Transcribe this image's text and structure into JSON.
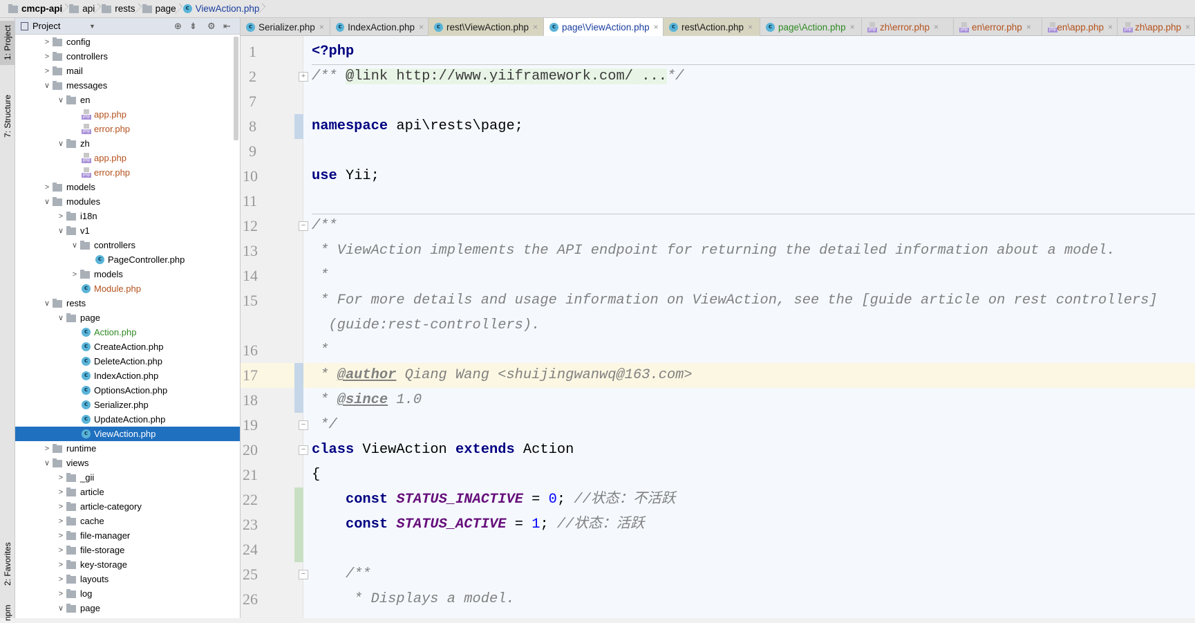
{
  "breadcrumb": [
    "cmcp-api",
    "api",
    "rests",
    "page",
    "ViewAction.php"
  ],
  "tool_strip": {
    "project": "1: Project",
    "structure": "7: Structure",
    "favorites": "2: Favorites",
    "npm": "npm"
  },
  "sidebar": {
    "title": "Project",
    "items": [
      {
        "label": "config",
        "level": 0,
        "type": "folder",
        "state": "collapsed"
      },
      {
        "label": "controllers",
        "level": 0,
        "type": "folder",
        "state": "collapsed"
      },
      {
        "label": "mail",
        "level": 0,
        "type": "folder",
        "state": "collapsed"
      },
      {
        "label": "messages",
        "level": 0,
        "type": "folder",
        "state": "expanded"
      },
      {
        "label": "en",
        "level": 1,
        "type": "folder",
        "state": "expanded"
      },
      {
        "label": "app.php",
        "level": 2,
        "type": "php",
        "color": "#b4511c"
      },
      {
        "label": "error.php",
        "level": 2,
        "type": "php",
        "color": "#b4511c"
      },
      {
        "label": "zh",
        "level": 1,
        "type": "folder",
        "state": "expanded"
      },
      {
        "label": "app.php",
        "level": 2,
        "type": "php",
        "color": "#b4511c"
      },
      {
        "label": "error.php",
        "level": 2,
        "type": "php",
        "color": "#b4511c"
      },
      {
        "label": "models",
        "level": 0,
        "type": "folder",
        "state": "collapsed"
      },
      {
        "label": "modules",
        "level": 0,
        "type": "folder",
        "state": "expanded"
      },
      {
        "label": "i18n",
        "level": 1,
        "type": "folder",
        "state": "collapsed"
      },
      {
        "label": "v1",
        "level": 1,
        "type": "folder",
        "state": "expanded"
      },
      {
        "label": "controllers",
        "level": 2,
        "type": "folder",
        "state": "expanded"
      },
      {
        "label": "PageController.php",
        "level": 3,
        "type": "class"
      },
      {
        "label": "models",
        "level": 2,
        "type": "folder",
        "state": "collapsed"
      },
      {
        "label": "Module.php",
        "level": 2,
        "type": "class",
        "color": "#b4511c"
      },
      {
        "label": "rests",
        "level": 0,
        "type": "folder",
        "state": "expanded"
      },
      {
        "label": "page",
        "level": 1,
        "type": "folder",
        "state": "expanded"
      },
      {
        "label": "Action.php",
        "level": 2,
        "type": "class",
        "color": "#2f8a24"
      },
      {
        "label": "CreateAction.php",
        "level": 2,
        "type": "class"
      },
      {
        "label": "DeleteAction.php",
        "level": 2,
        "type": "class"
      },
      {
        "label": "IndexAction.php",
        "level": 2,
        "type": "class"
      },
      {
        "label": "OptionsAction.php",
        "level": 2,
        "type": "class"
      },
      {
        "label": "Serializer.php",
        "level": 2,
        "type": "class"
      },
      {
        "label": "UpdateAction.php",
        "level": 2,
        "type": "class"
      },
      {
        "label": "ViewAction.php",
        "level": 2,
        "type": "class",
        "selected": true
      },
      {
        "label": "runtime",
        "level": 0,
        "type": "folder",
        "state": "collapsed"
      },
      {
        "label": "views",
        "level": 0,
        "type": "folder",
        "state": "expanded"
      },
      {
        "label": "_gii",
        "level": 1,
        "type": "folder",
        "state": "collapsed"
      },
      {
        "label": "article",
        "level": 1,
        "type": "folder",
        "state": "collapsed"
      },
      {
        "label": "article-category",
        "level": 1,
        "type": "folder",
        "state": "collapsed"
      },
      {
        "label": "cache",
        "level": 1,
        "type": "folder",
        "state": "collapsed"
      },
      {
        "label": "file-manager",
        "level": 1,
        "type": "folder",
        "state": "collapsed"
      },
      {
        "label": "file-storage",
        "level": 1,
        "type": "folder",
        "state": "collapsed"
      },
      {
        "label": "key-storage",
        "level": 1,
        "type": "folder",
        "state": "collapsed"
      },
      {
        "label": "layouts",
        "level": 1,
        "type": "folder",
        "state": "collapsed"
      },
      {
        "label": "log",
        "level": 1,
        "type": "folder",
        "state": "collapsed"
      },
      {
        "label": "page",
        "level": 1,
        "type": "folder",
        "state": "expanded"
      }
    ]
  },
  "tabs": [
    {
      "label": "Serializer.php",
      "icon": "class",
      "w": 130
    },
    {
      "label": "IndexAction.php",
      "icon": "class",
      "w": 142
    },
    {
      "label": "rest\\ViewAction.php",
      "icon": "class",
      "w": 167,
      "style": "olive"
    },
    {
      "label": "page\\ViewAction.php",
      "icon": "class",
      "w": 173,
      "active": true
    },
    {
      "label": "rest\\Action.php",
      "icon": "class",
      "w": 140,
      "style": "olive"
    },
    {
      "label": "page\\Action.php",
      "icon": "class",
      "w": 147,
      "color": "#2f8a24"
    },
    {
      "label": "zh\\error.php",
      "icon": "php",
      "w": 133,
      "color": "#b4511c"
    },
    {
      "label": "en\\error.php",
      "icon": "php",
      "w": 128,
      "color": "#b4511c"
    },
    {
      "label": "en\\app.php",
      "icon": "php",
      "w": 109,
      "color": "#b4511c"
    },
    {
      "label": "zh\\app.php",
      "icon": "php",
      "w": 112,
      "color": "#b4511c"
    }
  ],
  "code": [
    {
      "n": "1",
      "t": [
        [
          "kw",
          "<?php"
        ]
      ],
      "sep": true
    },
    {
      "n": "2",
      "fold": "+",
      "t": [
        [
          "cm",
          "/** "
        ],
        [
          "link",
          "@link http://www.yiiframework.com/ ..."
        ],
        [
          "cm",
          "*/"
        ]
      ]
    },
    {
      "n": "7",
      "t": []
    },
    {
      "n": "8",
      "mark": "#c5d6e8",
      "t": [
        [
          "kw",
          "namespace"
        ],
        [
          "tx",
          " api\\rests\\page;"
        ]
      ]
    },
    {
      "n": "9",
      "t": []
    },
    {
      "n": "10",
      "t": [
        [
          "kw",
          "use"
        ],
        [
          "tx",
          " Yii;"
        ]
      ]
    },
    {
      "n": "11",
      "t": [],
      "sep": true
    },
    {
      "n": "12",
      "fold": "−",
      "t": [
        [
          "cm",
          "/**"
        ]
      ]
    },
    {
      "n": "13",
      "t": [
        [
          "cm",
          " * ViewAction implements the API endpoint for returning the detailed information about a model."
        ]
      ]
    },
    {
      "n": "14",
      "t": [
        [
          "cm",
          " *"
        ]
      ]
    },
    {
      "n": "15",
      "t": [
        [
          "cm",
          " * For more details and usage information on ViewAction, see the [guide article on rest controllers]"
        ]
      ]
    },
    {
      "n": "",
      "t": [
        [
          "cm",
          "  (guide:rest-controllers)."
        ]
      ]
    },
    {
      "n": "16",
      "t": [
        [
          "cm",
          " *"
        ]
      ]
    },
    {
      "n": "17",
      "cur": true,
      "mark": "#c5d6e8",
      "t": [
        [
          "cm",
          " * "
        ],
        [
          "tag",
          "@author"
        ],
        [
          "cm",
          " Qiang Wang <shuijingwanwq@163.com>"
        ]
      ]
    },
    {
      "n": "18",
      "mark": "#c5d6e8",
      "t": [
        [
          "cm",
          " * "
        ],
        [
          "tag",
          "@since"
        ],
        [
          "cm",
          " 1.0"
        ]
      ]
    },
    {
      "n": "19",
      "fold": "−",
      "t": [
        [
          "cm",
          " */"
        ]
      ]
    },
    {
      "n": "20",
      "fold": "−",
      "t": [
        [
          "kw",
          "class"
        ],
        [
          "tx",
          " ViewAction "
        ],
        [
          "kw",
          "extends"
        ],
        [
          "tx",
          " Action"
        ]
      ]
    },
    {
      "n": "21",
      "t": [
        [
          "tx",
          "{"
        ]
      ]
    },
    {
      "n": "22",
      "mark": "#c9dfc3",
      "t": [
        [
          "tx",
          "    "
        ],
        [
          "kw",
          "const"
        ],
        [
          "tx",
          " "
        ],
        [
          "const",
          "STATUS_INACTIVE"
        ],
        [
          "tx",
          " = "
        ],
        [
          "num",
          "0"
        ],
        [
          "tx",
          "; "
        ],
        [
          "cm",
          "//状态：不活跃"
        ]
      ]
    },
    {
      "n": "23",
      "mark": "#c9dfc3",
      "t": [
        [
          "tx",
          "    "
        ],
        [
          "kw",
          "const"
        ],
        [
          "tx",
          " "
        ],
        [
          "const",
          "STATUS_ACTIVE"
        ],
        [
          "tx",
          " = "
        ],
        [
          "num",
          "1"
        ],
        [
          "tx",
          "; "
        ],
        [
          "cm",
          "//状态：活跃"
        ]
      ]
    },
    {
      "n": "24",
      "mark": "#c9dfc3",
      "t": []
    },
    {
      "n": "25",
      "fold": "−",
      "t": [
        [
          "tx",
          "    "
        ],
        [
          "cm",
          "/**"
        ]
      ]
    },
    {
      "n": "26",
      "t": [
        [
          "cm",
          "     * Displays a model."
        ]
      ]
    }
  ]
}
